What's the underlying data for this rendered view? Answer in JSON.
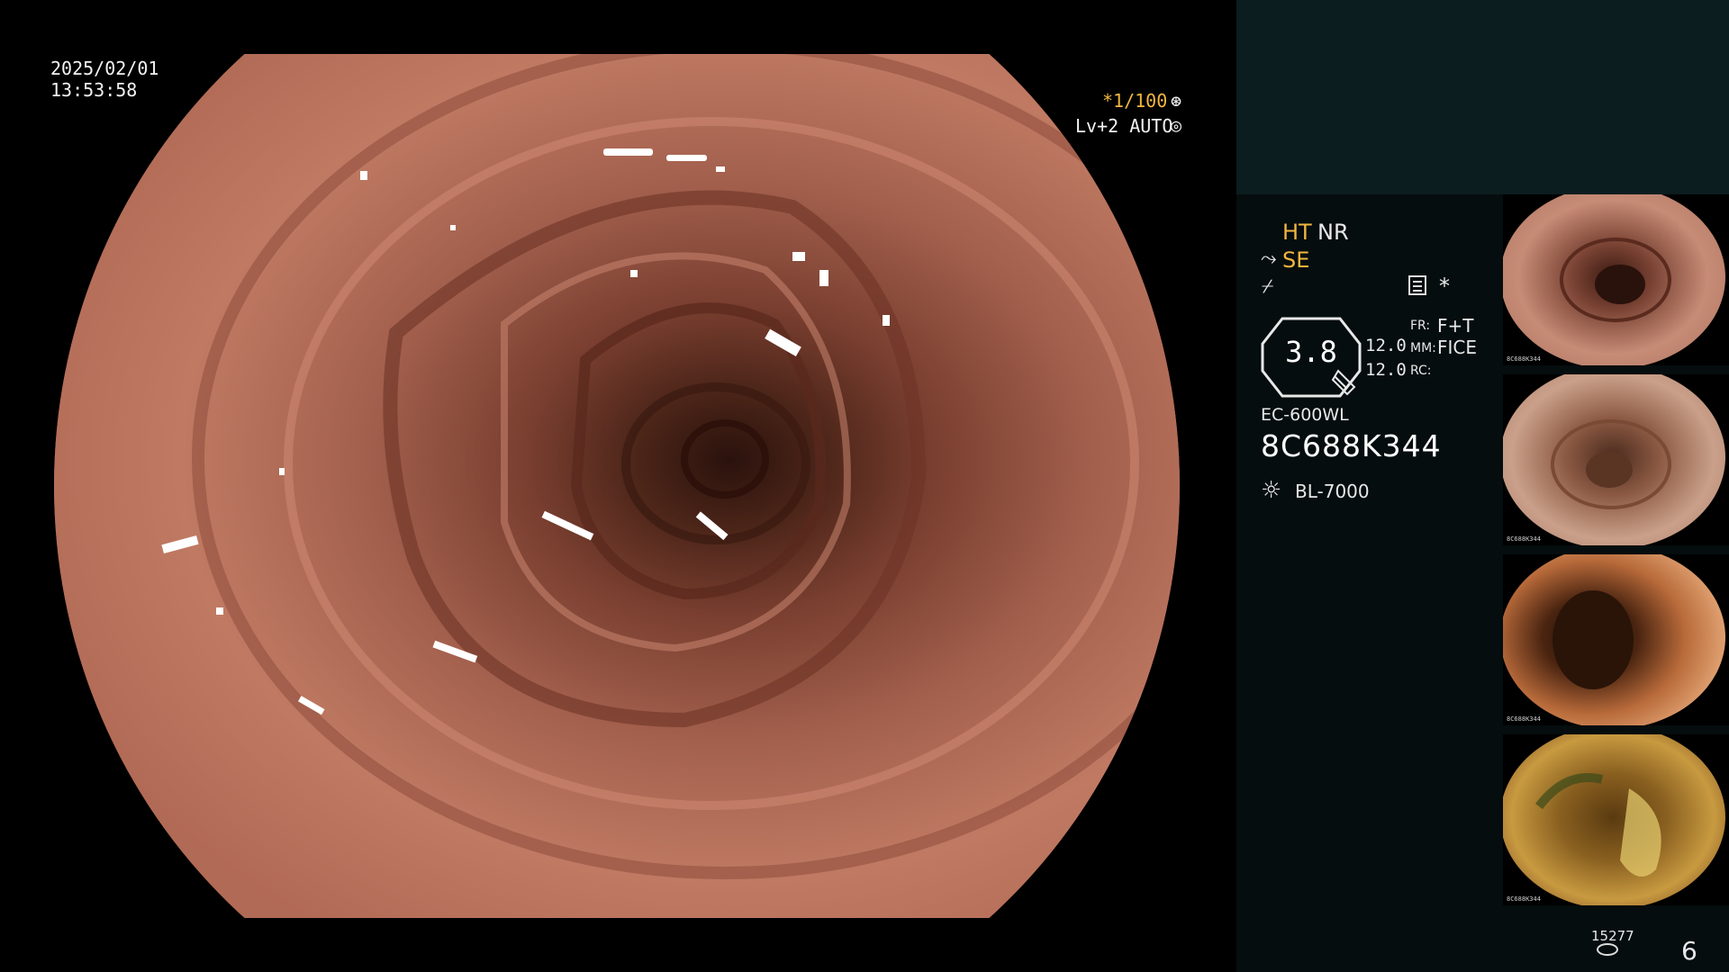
{
  "timestamp": {
    "date": "2025/02/01",
    "time": "13:53:58"
  },
  "exposure": {
    "shutter": "*1/100",
    "shutter_icon": "aperture-icon",
    "iris": "Lv+2 AUTO",
    "iris_icon": "iris-icon"
  },
  "image_settings": {
    "ht": "HT",
    "nr": "NR",
    "se": "SE",
    "se_icon": "structure-enhance-icon",
    "structure_icon": "structure-icon",
    "mode_icon": "memory-icon",
    "star": "*"
  },
  "zoom": {
    "value": "3.8",
    "value_a": "12.0",
    "value_b": "12.0",
    "fr_key": "FR:",
    "fr_val": "F+T",
    "mm_key": "MM:",
    "mm_val": "FICE",
    "rc_key": "RC:"
  },
  "scope": {
    "model": "EC-600WL",
    "serial": "8C688K344"
  },
  "light_source": {
    "icon": "light-source-icon",
    "model": "BL-7000"
  },
  "thumbnails": [
    {
      "caption": "8C688K344"
    },
    {
      "caption": "8C688K344"
    },
    {
      "caption": "8C688K344"
    },
    {
      "caption": "8C688K344"
    }
  ],
  "footer": {
    "capture_count": "15277",
    "page_number": "6"
  },
  "colors": {
    "accent": "#f2b640",
    "panel": "#050d0e",
    "panel_top": "#0c1d1f"
  }
}
